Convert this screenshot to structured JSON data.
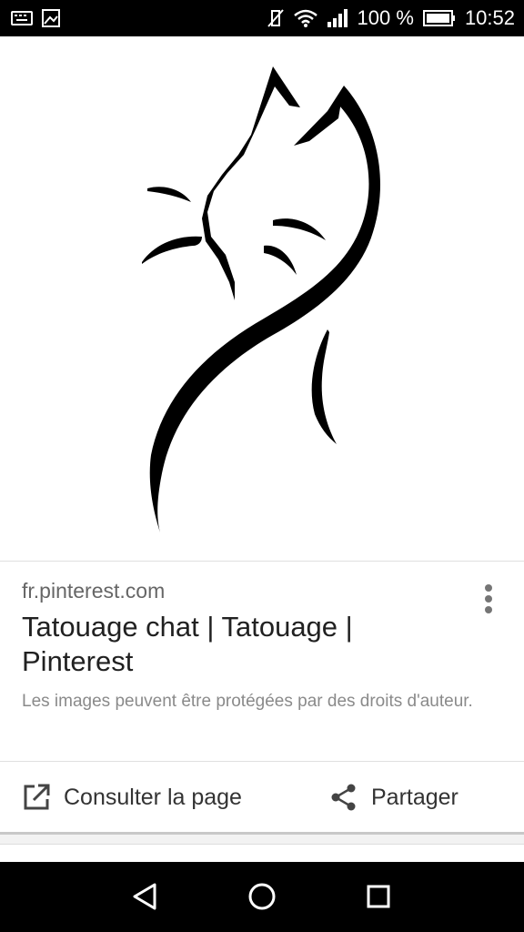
{
  "status_bar": {
    "battery_percent": "100 %",
    "time": "10:52",
    "icons": [
      "keyboard-icon",
      "image-icon",
      "vibrate-off-icon",
      "wifi-icon",
      "signal-icon",
      "battery-icon"
    ]
  },
  "result": {
    "domain": "fr.pinterest.com",
    "title": "Tatouage chat | Tatouage | Pinterest",
    "copyright_notice": "Les images peuvent être protégées par des droits d'auteur."
  },
  "actions": {
    "open_label": "Consulter la page",
    "share_label": "Partager"
  },
  "nav_bar": {
    "buttons": [
      "back-icon",
      "home-icon",
      "recents-icon"
    ]
  }
}
